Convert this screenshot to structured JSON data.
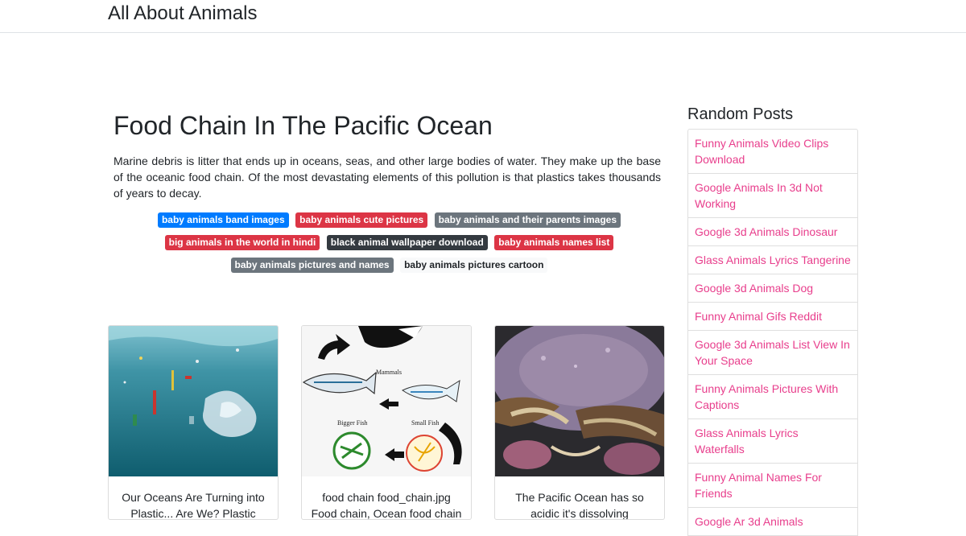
{
  "site": {
    "title": "All About Animals"
  },
  "post": {
    "title": "Food Chain In The Pacific Ocean",
    "intro": "Marine debris is litter that ends up in oceans, seas, and other large bodies of water. They make up the base of the oceanic food chain. Of the most devastating elements of this pollution is that plastics takes thousands of years to decay."
  },
  "tags": [
    [
      "baby animals band images",
      "baby animals cute pictures",
      "baby animals and their parents images"
    ],
    [
      "big animals in the world in hindi",
      "black animal wallpaper download",
      "baby animals names list"
    ],
    [
      "baby animals pictures and names",
      "baby animals pictures cartoon"
    ]
  ],
  "tag_colors": {
    "blue": "#007bff",
    "red": "#dc3545",
    "gray": "#6c757d",
    "dark": "#343a40",
    "light": "#f8f9fa"
  },
  "cards": [
    {
      "caption": "Our Oceans Are Turning into Plastic... Are We? Plastic",
      "image": "plastic-ocean-photo"
    },
    {
      "caption": "food chain food_chain.jpg Food chain, Ocean food chain",
      "image": "food-chain-diagram",
      "diagram_labels": {
        "mammals": "Mammals",
        "bigger_fish": "Bigger Fish",
        "small_fish": "Small Fish"
      }
    },
    {
      "caption": "The Pacific Ocean has so acidic it's dissolving",
      "image": "crab-photo"
    }
  ],
  "sidebar": {
    "title": "Random Posts",
    "items": [
      "Funny Animals Video Clips Download",
      "Google Animals In 3d Not Working",
      "Google 3d Animals Dinosaur",
      "Glass Animals Lyrics Tangerine",
      "Google 3d Animals Dog",
      "Funny Animal Gifs Reddit",
      "Google 3d Animals List View In Your Space",
      "Funny Animals Pictures With Captions",
      "Glass Animals Lyrics Waterfalls",
      "Funny Animal Names For Friends",
      "Google Ar 3d Animals"
    ],
    "link_color": "#e83e8c"
  }
}
